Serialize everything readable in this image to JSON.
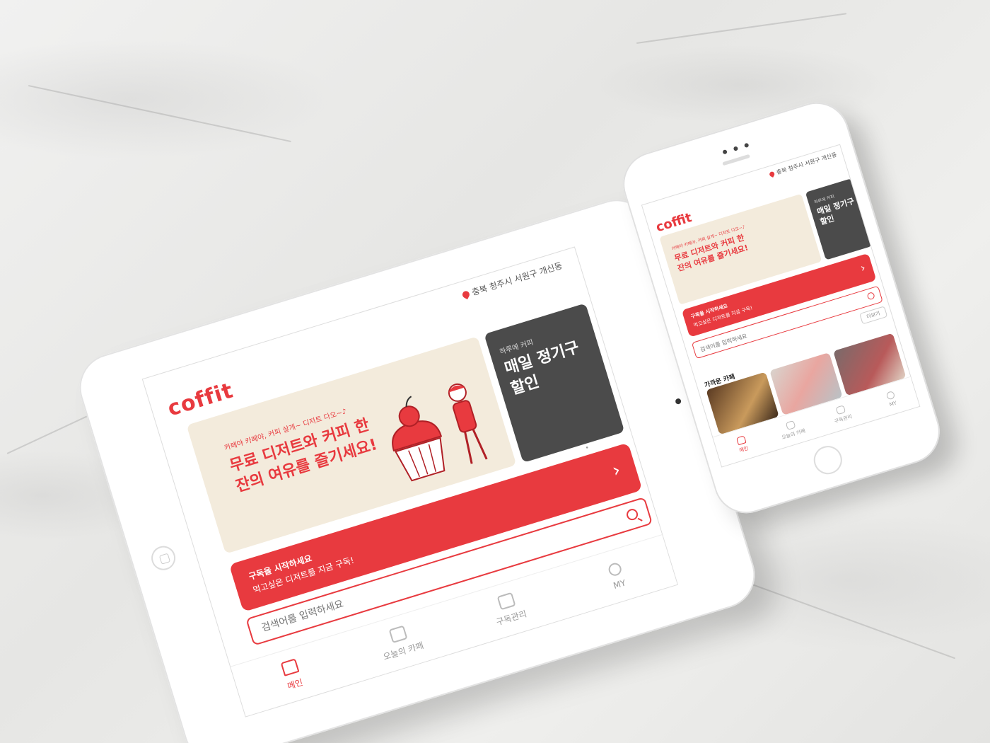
{
  "brand": {
    "logo": "coffit",
    "accent": "#e83a3f",
    "dark_banner": "#4b4b4b",
    "cream": "#f3ebdc"
  },
  "location": "충북 청주시 서원구 개신동",
  "banner_main": {
    "small": "카페야 카페야, 커피 살게~ 디저트 다오~♪",
    "title": "무료 디저트와 커피 한잔의 여유를 즐기세요!"
  },
  "banner_second": {
    "small": "하루에 커피",
    "title": "매일 정기구 할인"
  },
  "subscribe_cta": {
    "line1": "구독을 시작하세요",
    "line2": "먹고싶은 디저트를 지금 구독!",
    "arrow": "›"
  },
  "search": {
    "placeholder": "검색어를 입력하세요"
  },
  "more_button": "더보기",
  "nearby_section": "가까운 카페",
  "tabbar": [
    {
      "label": "메인",
      "icon": "home-icon",
      "active": true
    },
    {
      "label": "오늘의 카페",
      "icon": "cafe-icon",
      "active": false
    },
    {
      "label": "구독관리",
      "icon": "stamp-icon",
      "active": false
    },
    {
      "label": "MY",
      "icon": "person-icon",
      "active": false
    }
  ]
}
